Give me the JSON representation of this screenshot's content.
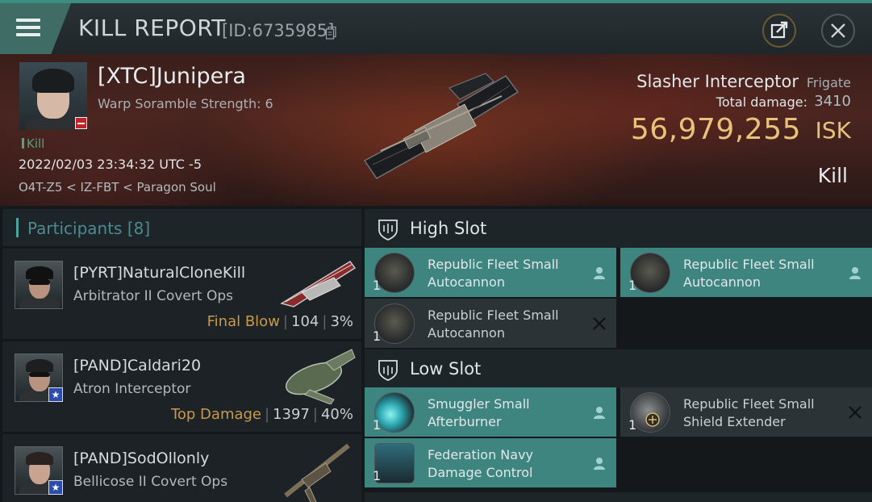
{
  "titlebar": {
    "title": "KILL REPORT",
    "report_id": "[ID:6735985]"
  },
  "victim": {
    "name": "[XTC]Junipera",
    "warp_scramble": "Warp Soramble Strength: 6",
    "kill_tag": "Kill",
    "datetime": "2022/02/03 23:34:32 UTC -5",
    "location": "O4T-Z5 < IZ-FBT < Paragon Soul",
    "ship_name": "Slasher Interceptor",
    "ship_class": "Frigate",
    "total_damage_label": "Total damage:",
    "total_damage": "3410",
    "isk_value": "56,979,255",
    "isk_unit": "ISK",
    "result": "Kill"
  },
  "participants": {
    "title": "Participants [8]",
    "rows": [
      {
        "name": "[PYRT]NaturalCloneKill",
        "ship": "Arbitrator II Covert Ops",
        "tag": "Final Blow",
        "damage": "104",
        "percent": "3%"
      },
      {
        "name": "[PAND]Caldari20",
        "ship": "Atron Interceptor",
        "tag": "Top Damage",
        "damage": "1397",
        "percent": "40%"
      },
      {
        "name": "[PAND]SodOllonly",
        "ship": "Bellicose II Covert Ops",
        "tag": "",
        "damage": "",
        "percent": ""
      }
    ]
  },
  "fitting": {
    "high_slot_title": "High Slot",
    "low_slot_title": "Low Slot",
    "high_slot": [
      {
        "name": "Republic Fleet Small Autocannon",
        "qty": "1",
        "status": "dropped"
      },
      {
        "name": "Republic Fleet Small Autocannon",
        "qty": "1",
        "status": "dropped"
      },
      {
        "name": "Republic Fleet Small Autocannon",
        "qty": "1",
        "status": "destroyed"
      }
    ],
    "low_slot": [
      {
        "name": "Smuggler Small Afterburner",
        "qty": "1",
        "status": "dropped"
      },
      {
        "name": "Republic Fleet Small Shield Extender",
        "qty": "1",
        "status": "destroyed"
      },
      {
        "name": "Federation Navy Damage Control",
        "qty": "1",
        "status": "dropped"
      }
    ]
  },
  "colors": {
    "accent_teal": "#3e8580",
    "isk_gold": "#e8c27a",
    "tag_gold": "#c79a4b",
    "kill_green": "#4fa57a"
  }
}
